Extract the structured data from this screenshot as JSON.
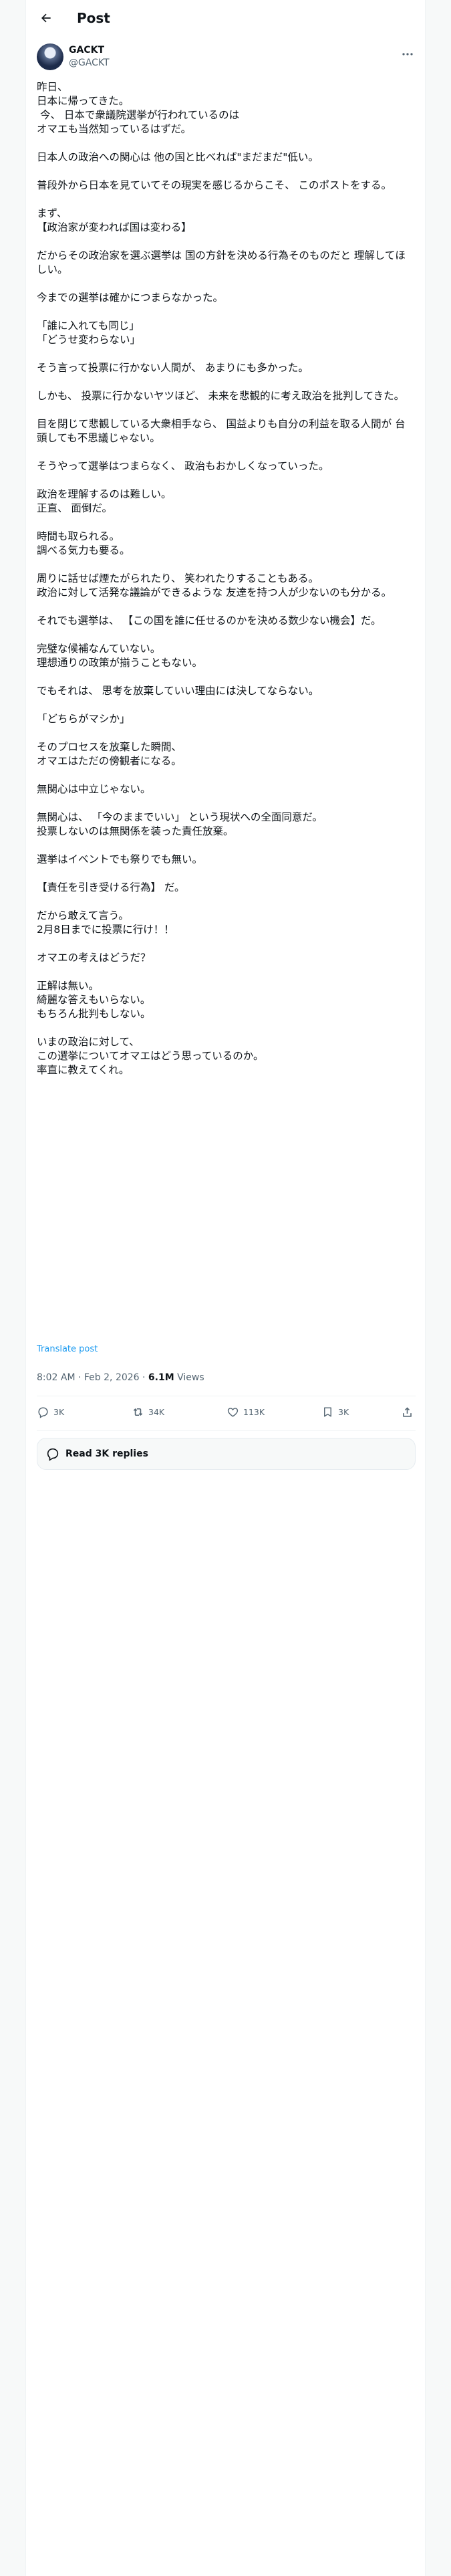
{
  "header": {
    "title": "Post"
  },
  "author": {
    "name": "GACKT",
    "handle": "@GACKT"
  },
  "post": {
    "text": "昨日、\n日本に帰ってきた。\n 今、 日本で衆議院選挙が行われているのは\nオマエも当然知っているはずだ。\n\n日本人の政治への関心は 他の国と比べれば\"まだまだ\"低い。\n\n普段外から日本を見ていてその現実を感じるからこそ、 このポストをする。\n\nまず、\n【政治家が変われば国は変わる】\n\nだからその政治家を選ぶ選挙は 国の方針を決める行為そのものだと 理解してほしい。\n\n今までの選挙は確かにつまらなかった。\n\n「誰に入れても同じ」\n「どうせ変わらない」\n\nそう言って投票に行かない人間が、 あまりにも多かった。\n\nしかも、 投票に行かないヤツほど、 未来を悲観的に考え政治を批判してきた。\n\n目を閉じて悲観している大衆相手なら、 国益よりも自分の利益を取る人間が 台頭しても不思議じゃない。\n\nそうやって選挙はつまらなく、 政治もおかしくなっていった。\n\n政治を理解するのは難しい。\n正直、 面倒だ。\n\n時間も取られる。\n調べる気力も要る。\n\n周りに話せば煙たがられたり、 笑われたりすることもある。\n政治に対して活発な議論ができるような 友達を持つ人が少ないのも分かる。\n\nそれでも選挙は、 【この国を誰に任せるのかを決める数少ない機会】だ。\n\n完璧な候補なんていない。\n理想通りの政策が揃うこともない。\n\nでもそれは、 思考を放棄していい理由には決してならない。\n\n「どちらがマシか」\n\nそのプロセスを放棄した瞬間、\nオマエはただの傍観者になる。\n\n無関心は中立じゃない。\n\n無関心は、 「今のままでいい」 という現状への全面同意だ。\n投票しないのは無関係を装った責任放棄。\n\n選挙はイベントでも祭りでも無い。\n\n【責任を引き受ける行為】 だ。\n\nだから敢えて言う。\n2月8日までに投票に行け！！\n\nオマエの考えはどうだ？\n\n正解は無い。\n綺麗な答えもいらない。\nもちろん批判もしない。\n\nいまの政治に対して、\nこの選挙についてオマエはどう思っているのか。\n率直に教えてくれ。",
    "translate_label": "Translate post",
    "time": "8:02 AM · Feb 2, 2026 · ",
    "views_count": "6.1M",
    "views_label": " Views"
  },
  "actions": {
    "replies": "3K",
    "reposts": "34K",
    "likes": "113K",
    "bookmarks": "3K"
  },
  "read_replies": {
    "label": "Read 3K replies"
  },
  "colors": {
    "link": "#1d9bf0",
    "muted": "#536471",
    "text": "#0f1419"
  }
}
